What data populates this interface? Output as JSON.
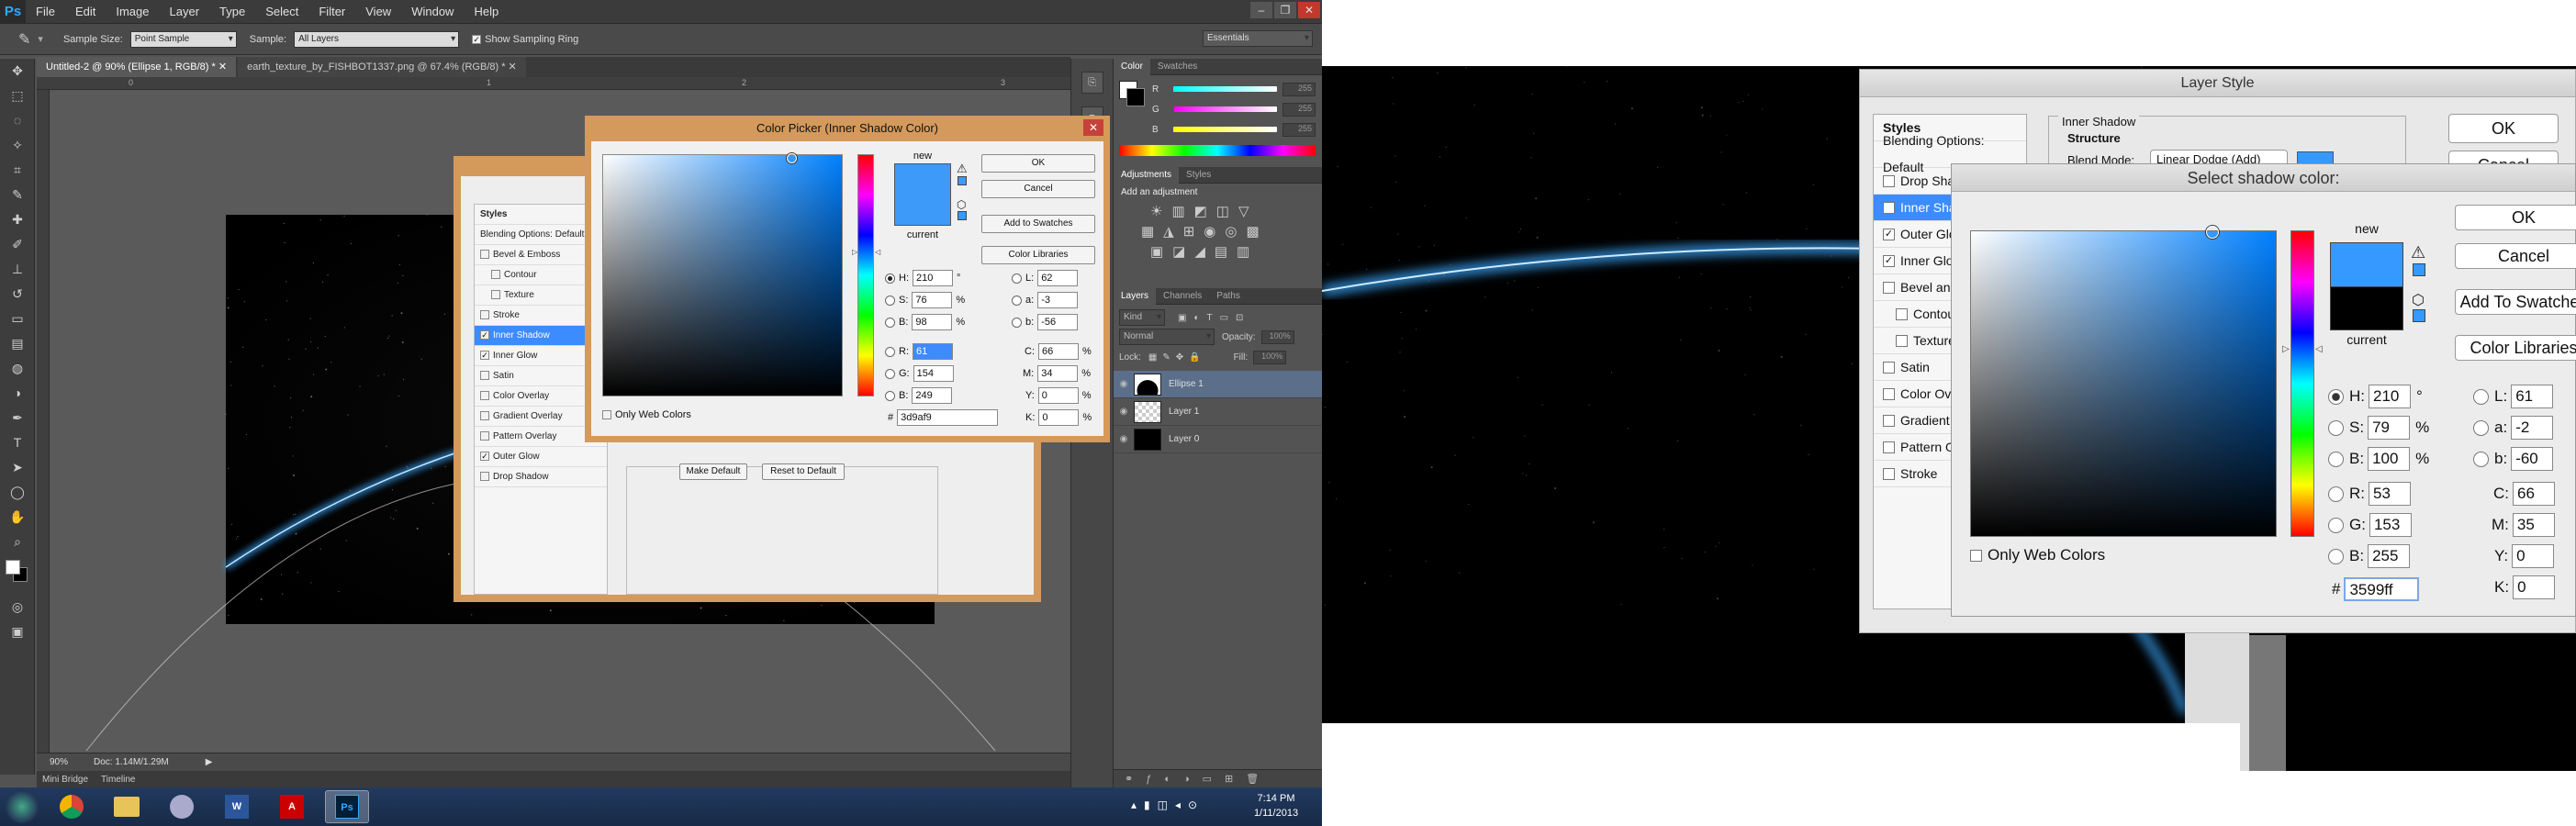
{
  "left": {
    "app_logo": "Ps",
    "menu": [
      "File",
      "Edit",
      "Image",
      "Layer",
      "Type",
      "Select",
      "Filter",
      "View",
      "Window",
      "Help"
    ],
    "options": {
      "sample_size_label": "Sample Size:",
      "sample_size_value": "Point Sample",
      "sample_label": "Sample:",
      "sample_value": "All Layers",
      "sampling_ring_label": "Show Sampling Ring",
      "workspace": "Essentials"
    },
    "tabs": [
      "Untitled-2 @ 90% (Ellipse 1, RGB/8) *",
      "earth_texture_by_FISHBOT1337.png @ 67.4% (RGB/8) *"
    ],
    "ruler_marks": [
      "0",
      "1",
      "2",
      "3"
    ],
    "status": {
      "zoom": "90%",
      "doc": "Doc: 1.14M/1.29M"
    },
    "bottom_tabs": [
      "Mini Bridge",
      "Timeline"
    ],
    "color_panel": {
      "tabs": [
        "Color",
        "Swatches"
      ],
      "channels": [
        "R",
        "G",
        "B"
      ],
      "values": [
        "255",
        "255",
        "255"
      ]
    },
    "adjustments_panel": {
      "tabs": [
        "Adjustments",
        "Styles"
      ],
      "title": "Add an adjustment"
    },
    "layers_panel": {
      "tabs": [
        "Layers",
        "Channels",
        "Paths"
      ],
      "kind": "Kind",
      "blend": "Normal",
      "opacity_label": "Opacity:",
      "opacity": "100%",
      "lock_label": "Lock:",
      "fill_label": "Fill:",
      "fill": "100%",
      "layers": [
        "Ellipse 1",
        "Layer 1",
        "Layer 0"
      ]
    },
    "layer_style": {
      "styles_header": "Styles",
      "blending": "Blending Options: Default",
      "items": [
        {
          "label": "Bevel & Emboss",
          "checked": false,
          "indent": false
        },
        {
          "label": "Contour",
          "checked": false,
          "indent": true
        },
        {
          "label": "Texture",
          "checked": false,
          "indent": true
        },
        {
          "label": "Stroke",
          "checked": false,
          "indent": false
        },
        {
          "label": "Inner Shadow",
          "checked": true,
          "indent": false,
          "highlight": true
        },
        {
          "label": "Inner Glow",
          "checked": true,
          "indent": false
        },
        {
          "label": "Satin",
          "checked": false,
          "indent": false
        },
        {
          "label": "Color Overlay",
          "checked": false,
          "indent": false
        },
        {
          "label": "Gradient Overlay",
          "checked": false,
          "indent": false
        },
        {
          "label": "Pattern Overlay",
          "checked": false,
          "indent": false
        },
        {
          "label": "Outer Glow",
          "checked": true,
          "indent": false
        },
        {
          "label": "Drop Shadow",
          "checked": false,
          "indent": false
        }
      ],
      "make_default": "Make Default",
      "reset_default": "Reset to Default"
    },
    "color_picker": {
      "title": "Color Picker (Inner Shadow Color)",
      "new_label": "new",
      "current_label": "current",
      "ok": "OK",
      "cancel": "Cancel",
      "add_swatches": "Add to Swatches",
      "libraries": "Color Libraries",
      "only_web": "Only Web Colors",
      "H": "210",
      "S": "76",
      "B": "98",
      "R": "61",
      "G": "154",
      "Bv": "249",
      "L": "62",
      "a": "-3",
      "b": "-56",
      "C": "66",
      "M": "34",
      "Y": "0",
      "K": "0",
      "hex": "3d9af9",
      "deg": "°",
      "pct": "%"
    },
    "taskbar": {
      "time": "7:14 PM",
      "date": "1/11/2013"
    }
  },
  "right": {
    "layer_style": {
      "title": "Layer Style",
      "styles_header": "Styles",
      "blending": "Blending Options: Default",
      "section": "Inner Shadow",
      "structure": "Structure",
      "blend_mode_label": "Blend Mode:",
      "blend_mode": "Linear Dodge (Add)",
      "ok": "OK",
      "cancel": "Cancel",
      "items": [
        {
          "label": "Drop Shadow",
          "checked": false
        },
        {
          "label": "Inner Shadow",
          "checked": true,
          "highlight": true
        },
        {
          "label": "Outer Glow",
          "checked": true
        },
        {
          "label": "Inner Glow",
          "checked": true
        },
        {
          "label": "Bevel and Emboss",
          "checked": false
        },
        {
          "label": "Contour",
          "checked": false,
          "indent": true
        },
        {
          "label": "Texture",
          "checked": false,
          "indent": true
        },
        {
          "label": "Satin",
          "checked": false
        },
        {
          "label": "Color Overlay",
          "checked": false
        },
        {
          "label": "Gradient Overlay",
          "checked": false
        },
        {
          "label": "Pattern Overlay",
          "checked": false
        },
        {
          "label": "Stroke",
          "checked": false
        }
      ]
    },
    "color_picker": {
      "title": "Select shadow color:",
      "new_label": "new",
      "current_label": "current",
      "ok": "OK",
      "cancel": "Cancel",
      "add_swatches": "Add To Swatches",
      "libraries": "Color Libraries",
      "only_web": "Only Web Colors",
      "H": "210",
      "S": "79",
      "B": "100",
      "R": "53",
      "G": "153",
      "Bv": "255",
      "L": "61",
      "a": "-2",
      "b": "-60",
      "C": "66",
      "M": "35",
      "Y": "0",
      "K": "0",
      "hex": "3599ff",
      "deg": "°",
      "pct": "%"
    }
  },
  "colors": {
    "new_color_left": "#3d9af9",
    "new_color_right": "#3599ff",
    "glow": "#3aa8ff",
    "dialog_border": "#d49a5c"
  }
}
